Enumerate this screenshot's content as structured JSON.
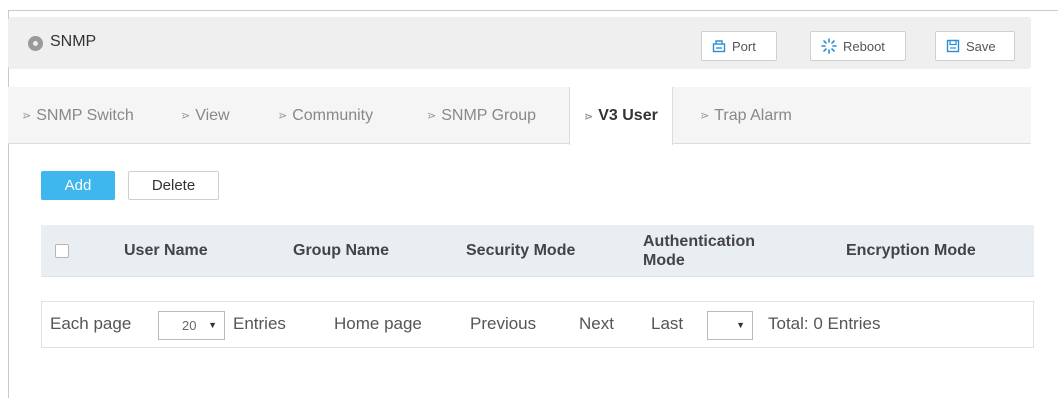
{
  "header": {
    "title": "SNMP",
    "buttons": {
      "port": "Port",
      "reboot": "Reboot",
      "save": "Save"
    }
  },
  "tabs": [
    {
      "label": "SNMP Switch",
      "active": false
    },
    {
      "label": "View",
      "active": false
    },
    {
      "label": "Community",
      "active": false
    },
    {
      "label": "SNMP Group",
      "active": false
    },
    {
      "label": "V3 User",
      "active": true
    },
    {
      "label": "Trap Alarm",
      "active": false
    }
  ],
  "actions": {
    "add": "Add",
    "delete": "Delete"
  },
  "table": {
    "columns": [
      "User Name",
      "Group Name",
      "Security Mode",
      "Authentication Mode",
      "Encryption Mode"
    ],
    "rows": []
  },
  "pager": {
    "each_page": "Each page",
    "page_size": "20",
    "entries": "Entries",
    "home": "Home page",
    "previous": "Previous",
    "next": "Next",
    "last": "Last",
    "page_select": "",
    "total": "Total: 0 Entries"
  },
  "colors": {
    "accent": "#3eb6ee",
    "header_bg": "#efefef",
    "table_header_bg": "#e9eef3"
  }
}
